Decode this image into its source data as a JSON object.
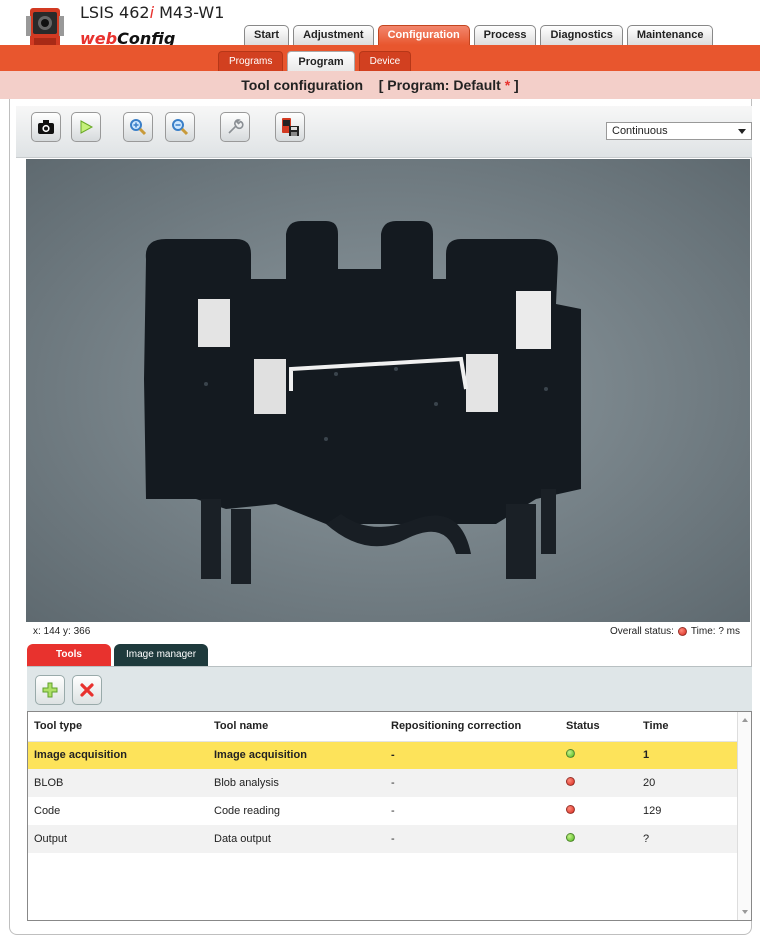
{
  "app": {
    "product_name": "LSIS 462",
    "product_italic": "i",
    "product_model": " M43-W1",
    "brand_web": "web",
    "brand_config": "Config"
  },
  "main_tabs": [
    {
      "label": "Start",
      "active": false
    },
    {
      "label": "Adjustment",
      "active": false
    },
    {
      "label": "Configuration",
      "active": true
    },
    {
      "label": "Process",
      "active": false
    },
    {
      "label": "Diagnostics",
      "active": false
    },
    {
      "label": "Maintenance",
      "active": false
    }
  ],
  "sub_tabs": [
    {
      "label": "Programs",
      "active": false
    },
    {
      "label": "Program",
      "active": true
    },
    {
      "label": "Device",
      "active": false
    }
  ],
  "page": {
    "title": "Tool configuration",
    "program_prefix": "[ Program: Default ",
    "program_star": "*",
    "program_suffix": " ]"
  },
  "toolbar": {
    "icons": [
      "camera-icon",
      "play-icon",
      "zoom-in-icon",
      "zoom-out-icon",
      "wrench-icon",
      "save-to-device-icon"
    ],
    "mode_select": "Continuous"
  },
  "status": {
    "coordinates": "x: 144 y: 366",
    "overall_label": "Overall status:",
    "overall_color": "#d8281e",
    "time_label": "Time: ? ms"
  },
  "bottom_tabs": [
    {
      "label": "Tools",
      "active": true
    },
    {
      "label": "Image manager",
      "active": false
    }
  ],
  "tools_table": {
    "columns": [
      "Tool type",
      "Tool name",
      "Repositioning correction",
      "Status",
      "Time"
    ],
    "rows": [
      {
        "type": "Image acquisition",
        "name": "Image acquisition",
        "repositioning": "-",
        "status": "green",
        "time": "1",
        "selected": true
      },
      {
        "type": "BLOB",
        "name": "Blob analysis",
        "repositioning": "-",
        "status": "red",
        "time": "20",
        "selected": false
      },
      {
        "type": "Code",
        "name": "Code reading",
        "repositioning": "-",
        "status": "red",
        "time": "129",
        "selected": false
      },
      {
        "type": "Output",
        "name": "Data output",
        "repositioning": "-",
        "status": "green",
        "time": "?",
        "selected": false
      }
    ]
  },
  "colors": {
    "accent": "#e8562e",
    "title_bar": "#f3cfc9",
    "selected_row": "#fde35a",
    "status_green": "#4cb81c",
    "status_red": "#d8281e"
  }
}
